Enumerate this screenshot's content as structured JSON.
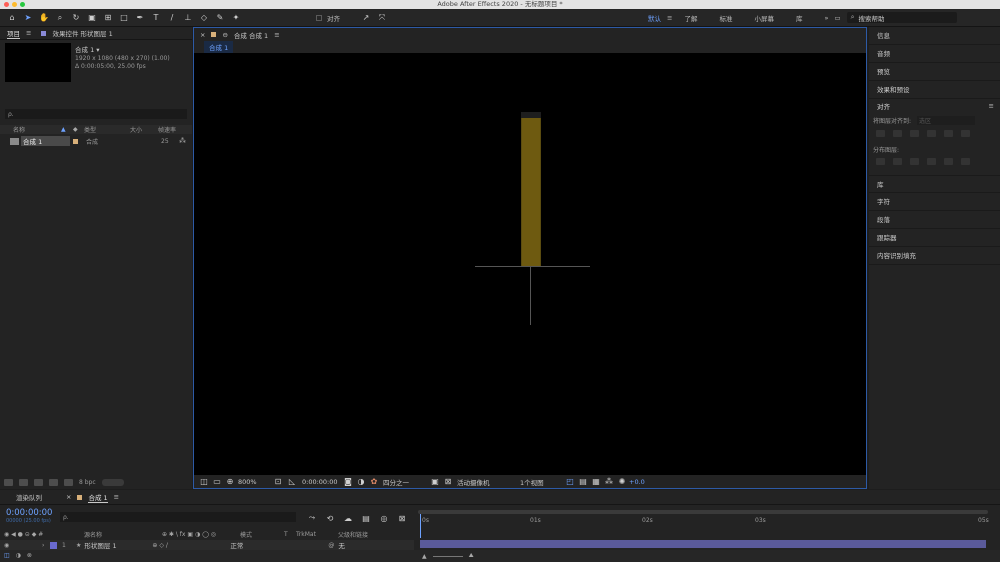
{
  "app": {
    "title": "Adobe After Effects 2020 - 无标题项目 *"
  },
  "toolbar": {
    "align_label": "对齐",
    "workspaces": [
      "默认",
      "了解",
      "标准",
      "小屏幕",
      "库"
    ],
    "search_placeholder": "搜索帮助"
  },
  "project_panel": {
    "tab_project": "项目",
    "tab_effects": "效果控件 形状图层 1",
    "comp_name": "合成 1 ▾",
    "comp_info1": "1920 x 1080  (480 x 270) (1.00)",
    "comp_info2": "Δ 0:00:05:00, 25.00 fps",
    "search_placeholder": "ρ.",
    "columns": [
      "名称",
      "类型",
      "大小",
      "帧速率"
    ],
    "items": [
      {
        "name": "合成 1",
        "type": "合成",
        "size": "",
        "fps": "25"
      }
    ],
    "bpc": "8 bpc"
  },
  "composition_panel": {
    "tab_label": "合成 合成 1",
    "breadcrumb": "合成 1",
    "zoom": "800%",
    "timecode": "0:00:00:00",
    "resolution": "四分之一",
    "camera": "活动摄像机",
    "views": "1个视图",
    "exposure": "+0.0",
    "layer_color": "#b8961a"
  },
  "right_panel": {
    "items_top": [
      "信息",
      "音频",
      "预览",
      "效果和预设"
    ],
    "align_title": "对齐",
    "align_to_label": "将图层对齐到:",
    "align_to_value": "选区",
    "distribute_label": "分布图层:",
    "items_bottom": [
      "库",
      "字符",
      "段落",
      "跟踪器",
      "内容识别填充"
    ]
  },
  "timeline": {
    "tab_render": "渲染队列",
    "tab_comp": "合成 1",
    "timecode": "0:00:00:00",
    "frames": "00000 (25.00 fps)",
    "search_placeholder": "ρ.",
    "columns": [
      "源名称",
      "模式",
      "T",
      "TrkMat",
      "父级和链接"
    ],
    "layer": {
      "index": "1",
      "name": "形状图层 1",
      "mode": "正常",
      "parent": "无"
    },
    "ruler": [
      "0s",
      "01s",
      "02s",
      "03s",
      "05s"
    ]
  }
}
